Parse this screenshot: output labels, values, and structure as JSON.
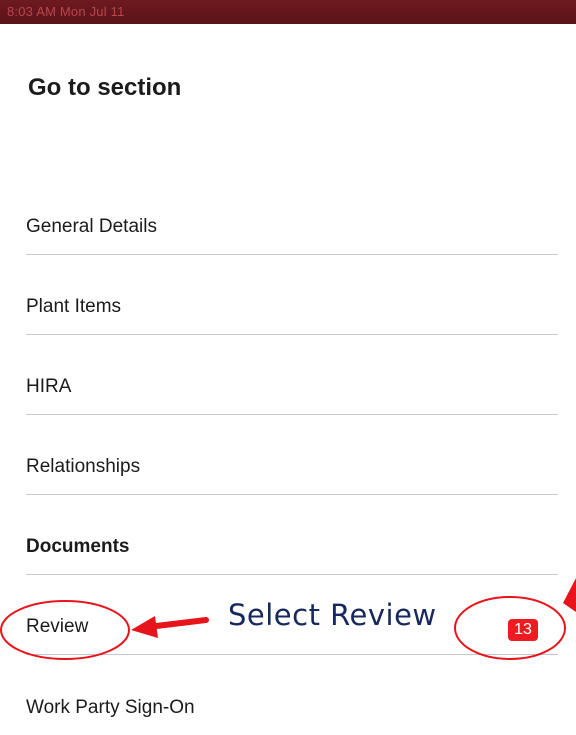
{
  "status_bar": {
    "time_date": "8:03 AM  Mon Jul 11"
  },
  "sheet": {
    "title": "Go to section",
    "sections": [
      {
        "label": "General Details"
      },
      {
        "label": "Plant Items"
      },
      {
        "label": "HIRA"
      },
      {
        "label": "Relationships"
      },
      {
        "label": "Documents",
        "bold": true
      },
      {
        "label": "Review",
        "badge": "13"
      },
      {
        "label": "Work Party Sign-On"
      }
    ]
  },
  "annotation": {
    "callout_text": "Select Review",
    "color": "#e8141b",
    "text_color": "#17285c"
  }
}
